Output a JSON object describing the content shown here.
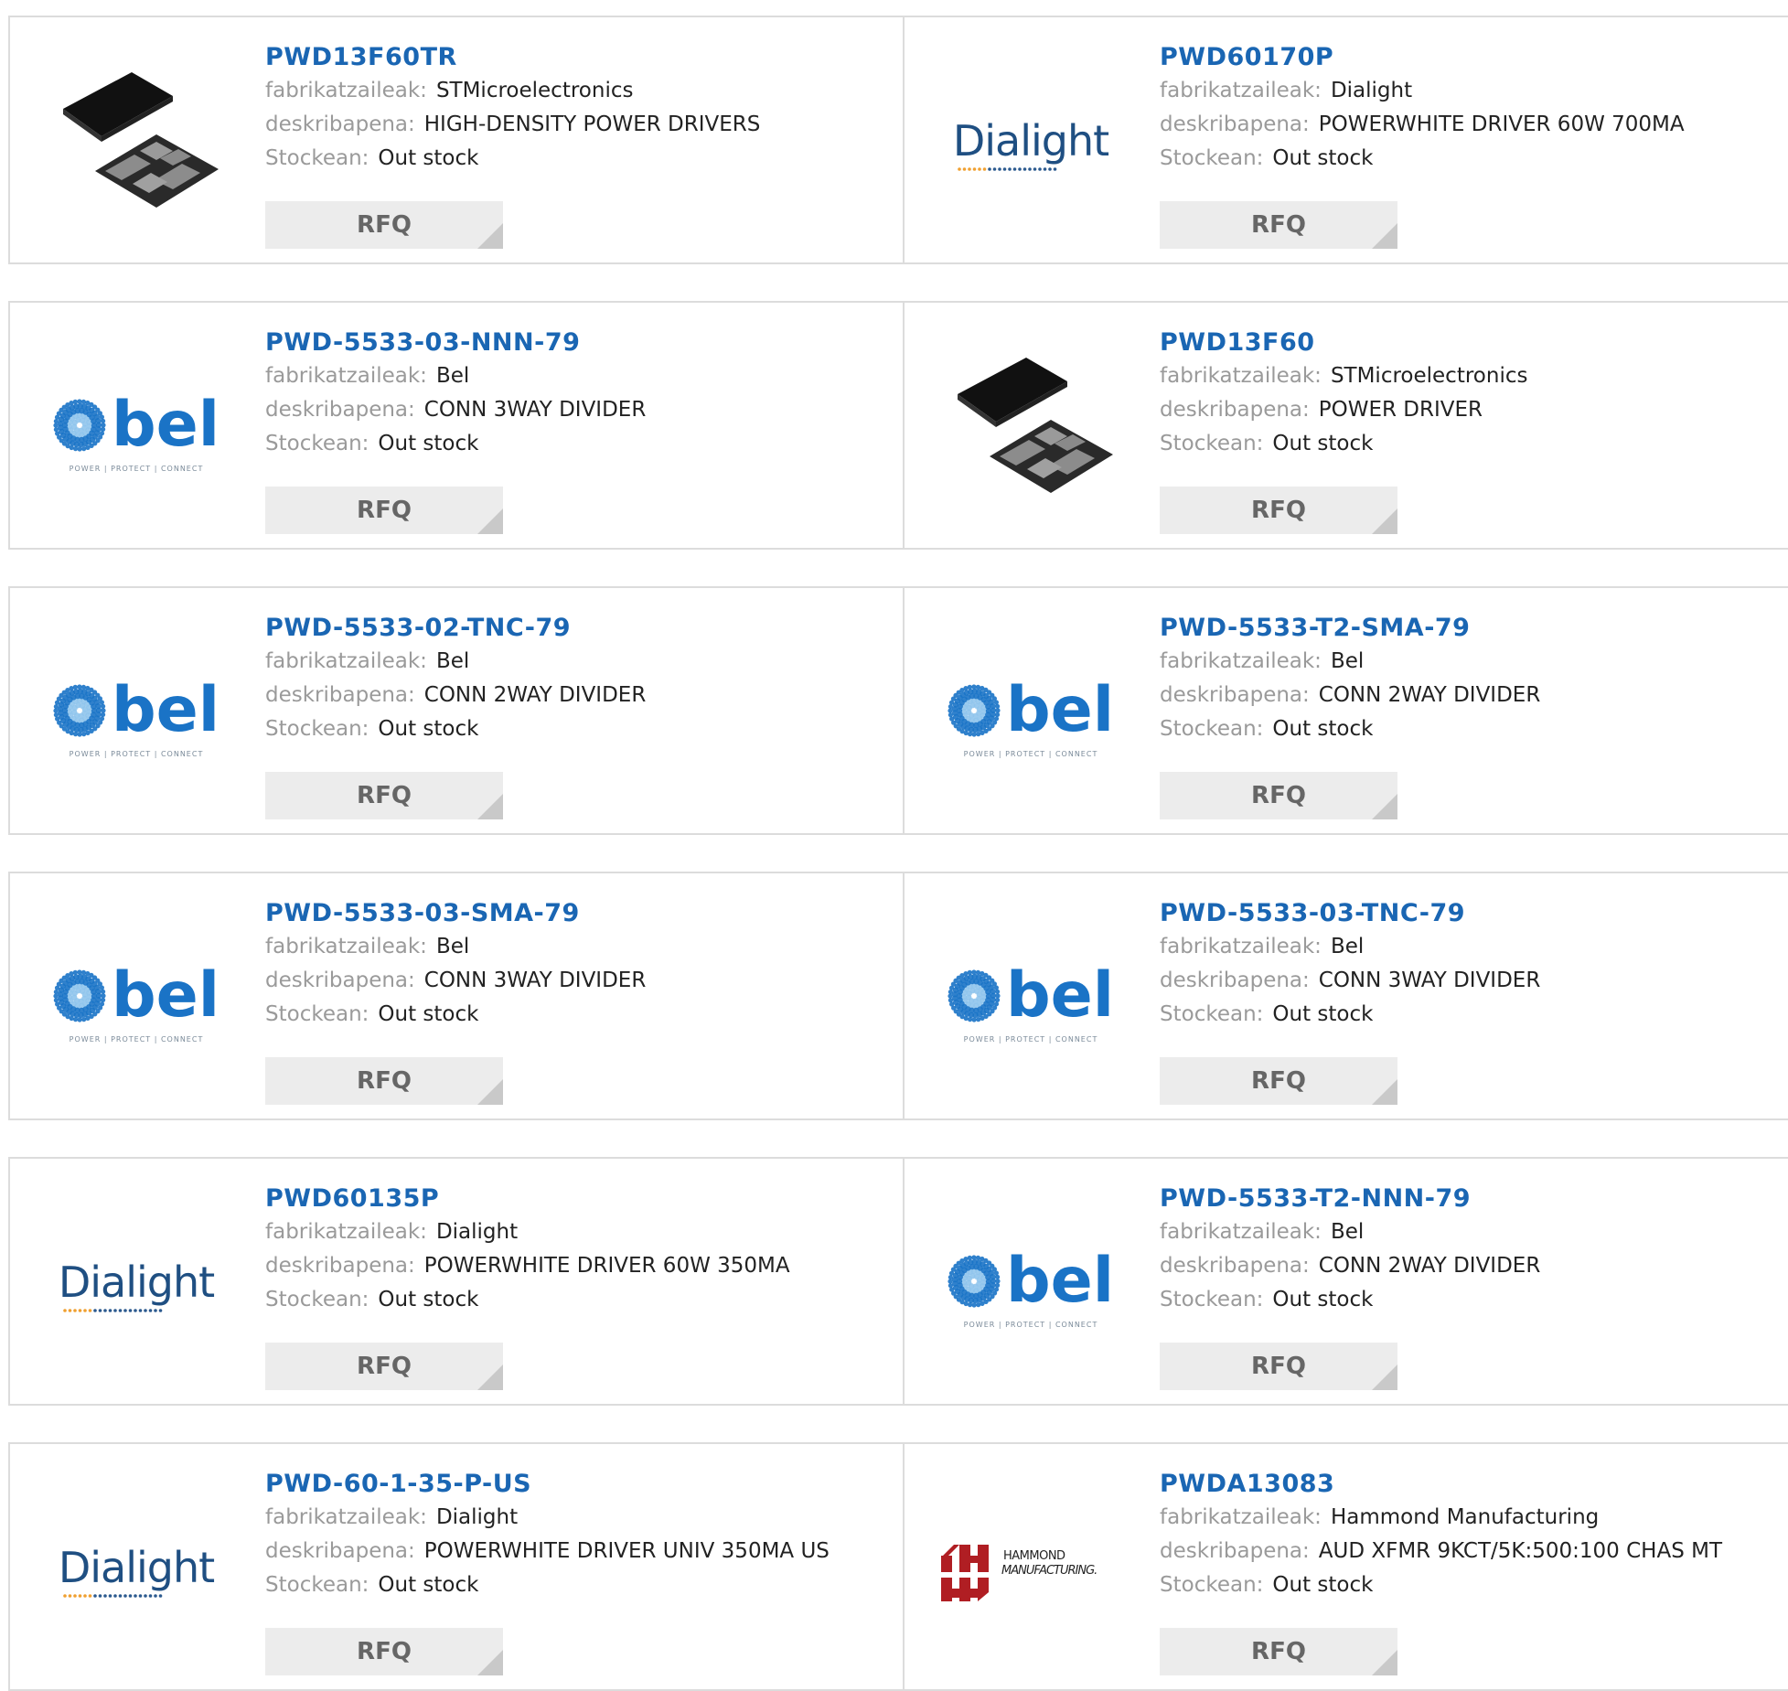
{
  "products": [
    {
      "part": "PWD13F60TR",
      "manufacturer_label": "fabrikatzaileak:",
      "manufacturer": "STMicroelectronics",
      "description_label": "deskribapena:",
      "description": "HIGH-DENSITY POWER DRIVERS",
      "stock_label": "Stockean:",
      "stock": "Out stock",
      "button": "RFQ",
      "logo": "chip-image"
    },
    {
      "part": "PWD60170P",
      "manufacturer_label": "fabrikatzaileak:",
      "manufacturer": "Dialight",
      "description_label": "deskribapena:",
      "description": "POWERWHITE DRIVER 60W 700MA",
      "stock_label": "Stockean:",
      "stock": "Out stock",
      "button": "RFQ",
      "logo": "dialight-logo"
    },
    {
      "part": "PWD-5533-03-NNN-79",
      "manufacturer_label": "fabrikatzaileak:",
      "manufacturer": "Bel",
      "description_label": "deskribapena:",
      "description": "CONN 3WAY DIVIDER",
      "stock_label": "Stockean:",
      "stock": "Out stock",
      "button": "RFQ",
      "logo": "bel-logo"
    },
    {
      "part": "PWD13F60",
      "manufacturer_label": "fabrikatzaileak:",
      "manufacturer": "STMicroelectronics",
      "description_label": "deskribapena:",
      "description": "POWER DRIVER",
      "stock_label": "Stockean:",
      "stock": "Out stock",
      "button": "RFQ",
      "logo": "chip-image"
    },
    {
      "part": "PWD-5533-02-TNC-79",
      "manufacturer_label": "fabrikatzaileak:",
      "manufacturer": "Bel",
      "description_label": "deskribapena:",
      "description": "CONN 2WAY DIVIDER",
      "stock_label": "Stockean:",
      "stock": "Out stock",
      "button": "RFQ",
      "logo": "bel-logo"
    },
    {
      "part": "PWD-5533-T2-SMA-79",
      "manufacturer_label": "fabrikatzaileak:",
      "manufacturer": "Bel",
      "description_label": "deskribapena:",
      "description": "CONN 2WAY DIVIDER",
      "stock_label": "Stockean:",
      "stock": "Out stock",
      "button": "RFQ",
      "logo": "bel-logo"
    },
    {
      "part": "PWD-5533-03-SMA-79",
      "manufacturer_label": "fabrikatzaileak:",
      "manufacturer": "Bel",
      "description_label": "deskribapena:",
      "description": "CONN 3WAY DIVIDER",
      "stock_label": "Stockean:",
      "stock": "Out stock",
      "button": "RFQ",
      "logo": "bel-logo"
    },
    {
      "part": "PWD-5533-03-TNC-79",
      "manufacturer_label": "fabrikatzaileak:",
      "manufacturer": "Bel",
      "description_label": "deskribapena:",
      "description": "CONN 3WAY DIVIDER",
      "stock_label": "Stockean:",
      "stock": "Out stock",
      "button": "RFQ",
      "logo": "bel-logo"
    },
    {
      "part": "PWD60135P",
      "manufacturer_label": "fabrikatzaileak:",
      "manufacturer": "Dialight",
      "description_label": "deskribapena:",
      "description": "POWERWHITE DRIVER 60W 350MA",
      "stock_label": "Stockean:",
      "stock": "Out stock",
      "button": "RFQ",
      "logo": "dialight-logo"
    },
    {
      "part": "PWD-5533-T2-NNN-79",
      "manufacturer_label": "fabrikatzaileak:",
      "manufacturer": "Bel",
      "description_label": "deskribapena:",
      "description": "CONN 2WAY DIVIDER",
      "stock_label": "Stockean:",
      "stock": "Out stock",
      "button": "RFQ",
      "logo": "bel-logo"
    },
    {
      "part": "PWD-60-1-35-P-US",
      "manufacturer_label": "fabrikatzaileak:",
      "manufacturer": "Dialight",
      "description_label": "deskribapena:",
      "description": "POWERWHITE DRIVER UNIV 350MA US",
      "stock_label": "Stockean:",
      "stock": "Out stock",
      "button": "RFQ",
      "logo": "dialight-logo"
    },
    {
      "part": "PWDA13083",
      "manufacturer_label": "fabrikatzaileak:",
      "manufacturer": "Hammond Manufacturing",
      "description_label": "deskribapena:",
      "description": "AUD XFMR 9KCT/5K:500:100 CHAS MT",
      "stock_label": "Stockean:",
      "stock": "Out stock",
      "button": "RFQ",
      "logo": "hammond-logo"
    }
  ],
  "logos": {
    "dialight": {
      "text": "Dialight",
      "color": "#1f4f82"
    },
    "bel": {
      "text": "bel",
      "tagline": "POWER | PROTECT | CONNECT",
      "color": "#1a73c6"
    },
    "hammond": {
      "line1": "HAMMOND",
      "line2": "MANUFACTURING.",
      "color": "#b01e23"
    }
  }
}
